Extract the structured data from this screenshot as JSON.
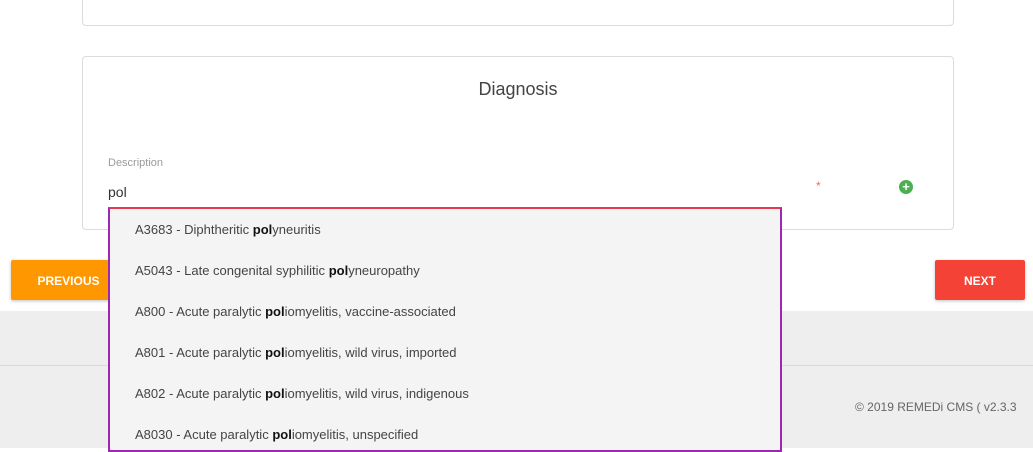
{
  "diagnosis": {
    "title": "Diagnosis",
    "description_label": "Description",
    "description_value": "pol",
    "required_mark": "*",
    "add_icon": "plus-circle-icon"
  },
  "suggestions": [
    {
      "pre": "A3683 - Diphtheritic ",
      "match": "pol",
      "post": "yneuritis"
    },
    {
      "pre": "A5043 - Late congenital syphilitic ",
      "match": "pol",
      "post": "yneuropathy"
    },
    {
      "pre": "A800 - Acute paralytic ",
      "match": "pol",
      "post": "iomyelitis, vaccine-associated"
    },
    {
      "pre": "A801 - Acute paralytic ",
      "match": "pol",
      "post": "iomyelitis, wild virus, imported"
    },
    {
      "pre": "A802 - Acute paralytic ",
      "match": "pol",
      "post": "iomyelitis, wild virus, indigenous"
    },
    {
      "pre": "A8030 - Acute paralytic ",
      "match": "pol",
      "post": "iomyelitis, unspecified"
    }
  ],
  "nav": {
    "previous_label": "PREVIOUS",
    "next_label": "NEXT"
  },
  "footer": {
    "copyright": "© 2019 REMEDi CMS ( v2.3.3"
  },
  "colors": {
    "previous": "#ff9800",
    "next": "#f44336",
    "add_icon": "#4caf50",
    "dropdown_border": "#9c27b0"
  }
}
